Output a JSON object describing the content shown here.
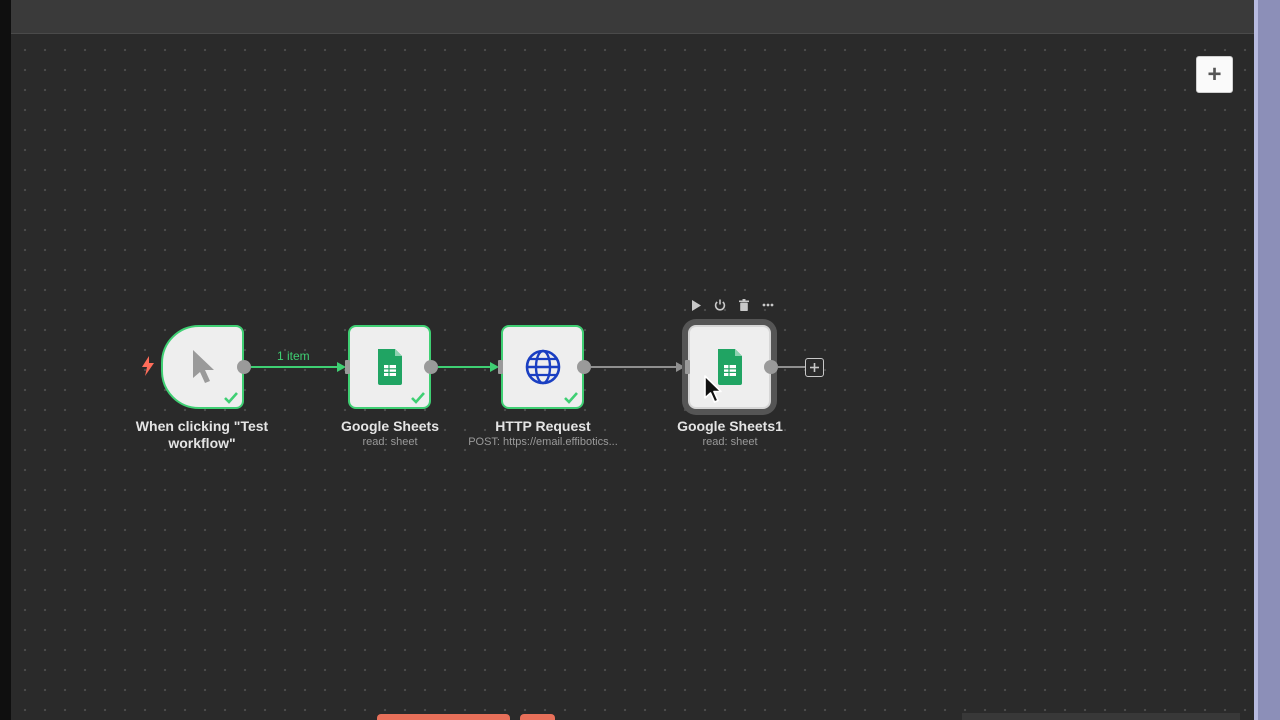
{
  "canvas": {
    "add_node_label": "+"
  },
  "nodes": [
    {
      "id": "trigger",
      "title": "When clicking \"Test workflow\"",
      "subtitle": "",
      "icon": "pointer-cursor-icon",
      "status": "success"
    },
    {
      "id": "sheets",
      "title": "Google Sheets",
      "subtitle": "read: sheet",
      "icon": "google-sheets-icon",
      "status": "success"
    },
    {
      "id": "http",
      "title": "HTTP Request",
      "subtitle": "POST: https://email.effibotics...",
      "icon": "globe-icon",
      "status": "success"
    },
    {
      "id": "sheets1",
      "title": "Google Sheets1",
      "subtitle": "read: sheet",
      "icon": "google-sheets-icon",
      "status": "selected"
    }
  ],
  "connections": {
    "first_edge_label": "1 item"
  },
  "node_toolbar": {
    "actions": [
      "execute-node",
      "deactivate-node",
      "delete-node",
      "more-options"
    ]
  },
  "colors": {
    "success": "#3fcf73",
    "canvas_bg": "#2a2a2a",
    "trigger_bolt": "#ff6d5a",
    "http_globe": "#1a3fc2",
    "sheets_green": "#20a463"
  }
}
